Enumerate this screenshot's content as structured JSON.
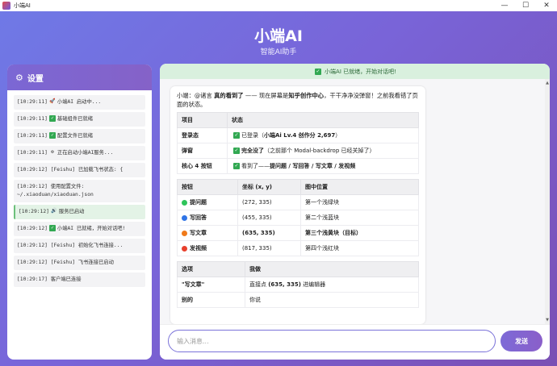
{
  "window": {
    "title": "小端AI",
    "controls": [
      "—",
      "☐",
      "✕"
    ]
  },
  "header": {
    "title": "小端AI",
    "subtitle": "智能AI助手"
  },
  "sidebar": {
    "title": "设置",
    "logs": [
      {
        "time": "[10:29:11]",
        "icon": "rocket-icon",
        "glyph": "🚀",
        "text": "小端AI 启动中..."
      },
      {
        "time": "[10:29:11]",
        "icon": "check-icon",
        "glyph": "✓",
        "text": "基础组件已就绪"
      },
      {
        "time": "[10:29:11]",
        "icon": "check-icon",
        "glyph": "✓",
        "text": "配置文件已就绪"
      },
      {
        "time": "[10:29:11]",
        "icon": "gear-icon",
        "glyph": "⚙",
        "text": "正在启动小端AI服务..."
      },
      {
        "time": "[10:29:12]",
        "text": "[Feishu] 已加载飞书状态: {"
      },
      {
        "time": "[10:29:12]",
        "text": "使用配置文件: ~/.xiaoduan/xiaoduan.json"
      },
      {
        "time": "[10:29:12]",
        "icon": "speaker-icon",
        "glyph": "🔊",
        "text": "服务已启动"
      },
      {
        "time": "[10:29:12]",
        "icon": "check-icon",
        "glyph": "✓",
        "text": "小端AI 已就绪，开始对话吧!"
      },
      {
        "time": "[10:29:12]",
        "text": "[Feishu] 初始化飞书连接..."
      },
      {
        "time": "[10:29:12]",
        "text": "[Feishu] 飞书连接已启动"
      },
      {
        "time": "[10:29:17]",
        "text": "客户端已连接"
      }
    ]
  },
  "main": {
    "status": "小端AI 已就绪，开始对话吧!",
    "message": {
      "intro_prefix": "小端：@诸言 ",
      "intro_bold1": "真的看到了",
      "intro_mid": " —— 现在屏幕是",
      "intro_bold2": "知乎创作中心",
      "intro_suffix": "，干干净净没弹窗！之前我看错了页面的状态。",
      "table1": {
        "headers": [
          "项目",
          "状态"
        ],
        "rows": [
          {
            "item": "登录态",
            "status_pre": "已登录（",
            "status_bold": "小端Ai Lv.4 创作分 2,697",
            "status_post": "）"
          },
          {
            "item": "弹窗",
            "status_pre": "",
            "status_bold": "完全没了",
            "status_post": "（之前那个 Modal-backdrop 已经关掉了）"
          },
          {
            "item": "核心 4 按钮",
            "status_pre": "看到了——",
            "status_bold": "提问题 / 写回答 / 写文章 / 发视频",
            "status_post": ""
          }
        ]
      },
      "table2": {
        "headers": [
          "按钮",
          "坐标 (x, y)",
          "图中位置"
        ],
        "rows": [
          {
            "name": "提问题",
            "color": "#2ec45a",
            "coord": "(272, 335)",
            "pos": "第一个浅绿块",
            "bold": false
          },
          {
            "name": "写回答",
            "color": "#2f74e6",
            "coord": "(455, 335)",
            "pos": "第二个浅蓝块",
            "bold": false
          },
          {
            "name": "写文章",
            "color": "#f07a1a",
            "coord": "(635, 335)",
            "pos": "第三个浅黄块（目标）",
            "bold": true
          },
          {
            "name": "发视频",
            "color": "#e8402d",
            "coord": "(817, 335)",
            "pos": "第四个浅红块",
            "bold": false
          }
        ]
      },
      "table3": {
        "headers": [
          "选项",
          "我做"
        ],
        "rows": [
          {
            "option": "\"写文章\"",
            "action_pre": "直接点 ",
            "action_bold": "(635, 335)",
            "action_post": " 进编辑器"
          },
          {
            "option": "别的",
            "action_pre": "你说",
            "action_bold": "",
            "action_post": ""
          }
        ]
      }
    },
    "input": {
      "placeholder": "输入消息..."
    },
    "send_label": "发送"
  },
  "colors": {
    "accent": "#7b67d4",
    "status_bg": "#d9f0de",
    "success": "#32a852"
  }
}
